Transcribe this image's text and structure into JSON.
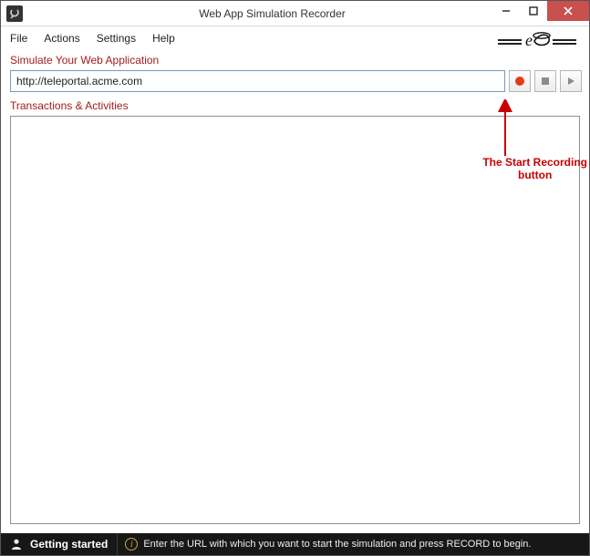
{
  "window": {
    "title": "Web App Simulation Recorder"
  },
  "menu": {
    "items": [
      "File",
      "Actions",
      "Settings",
      "Help"
    ]
  },
  "sections": {
    "simulate_label": "Simulate Your Web Application",
    "transactions_label": "Transactions & Activities"
  },
  "url": {
    "value": "http://teleportal.acme.com"
  },
  "annotation": {
    "line1": "The Start Recording",
    "line2": "button"
  },
  "status": {
    "left": "Getting started",
    "right": "Enter the URL with which you want to start the simulation and press RECORD to begin."
  },
  "colors": {
    "accent": "#a11c1c",
    "record": "#e33b16",
    "close": "#c8504f"
  }
}
